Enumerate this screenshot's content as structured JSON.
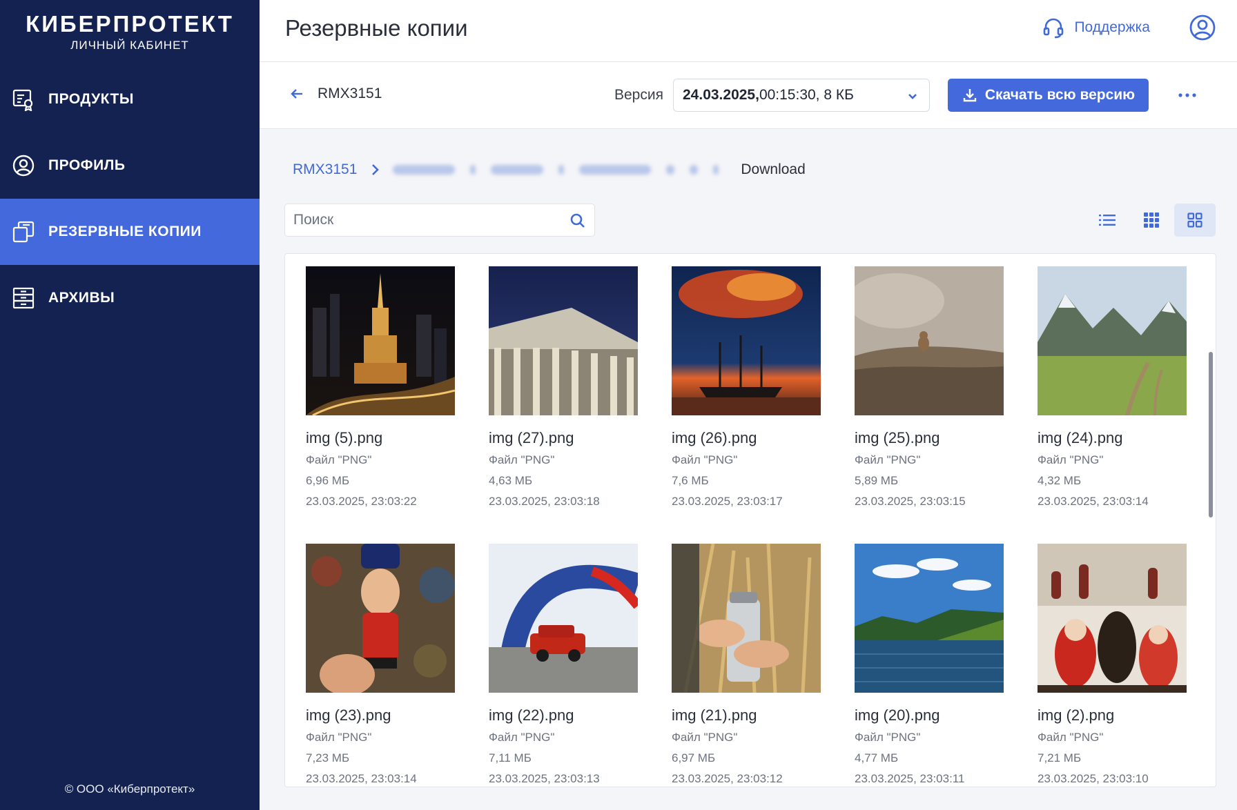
{
  "brand": {
    "name": "КИБЕРПРОТЕКТ",
    "subtitle": "ЛИЧНЫЙ КАБИНЕТ"
  },
  "nav": [
    {
      "label": "ПРОДУКТЫ",
      "icon": "products-icon",
      "active": false
    },
    {
      "label": "ПРОФИЛЬ",
      "icon": "profile-icon",
      "active": false
    },
    {
      "label": "РЕЗЕРВНЫЕ КОПИИ",
      "icon": "backups-icon",
      "active": true
    },
    {
      "label": "АРХИВЫ",
      "icon": "archives-icon",
      "active": false
    }
  ],
  "copyright": "© ООО «Киберпротект»",
  "header": {
    "title": "Резервные копии",
    "support": "Поддержка"
  },
  "versionbar": {
    "device": "RMX3151",
    "version_label": "Версия",
    "version_date": "24.03.2025,",
    "version_rest": "00:15:30, 8 КБ",
    "download": "Скачать всю версию"
  },
  "breadcrumb": {
    "root": "RMX3151",
    "current": "Download"
  },
  "search": {
    "placeholder": "Поиск",
    "value": ""
  },
  "colors": {
    "sidebar": "#142251",
    "accent": "#4469dd",
    "link": "#4169d8"
  },
  "files": [
    {
      "name": "img (5).png",
      "type": "Файл \"PNG\"",
      "size": "6,96 МБ",
      "date": "23.03.2025, 23:03:22"
    },
    {
      "name": "img (27).png",
      "type": "Файл \"PNG\"",
      "size": "4,63 МБ",
      "date": "23.03.2025, 23:03:18"
    },
    {
      "name": "img (26).png",
      "type": "Файл \"PNG\"",
      "size": "7,6 МБ",
      "date": "23.03.2025, 23:03:17"
    },
    {
      "name": "img (25).png",
      "type": "Файл \"PNG\"",
      "size": "5,89 МБ",
      "date": "23.03.2025, 23:03:15"
    },
    {
      "name": "img (24).png",
      "type": "Файл \"PNG\"",
      "size": "4,32 МБ",
      "date": "23.03.2025, 23:03:14"
    },
    {
      "name": "img (23).png",
      "type": "Файл \"PNG\"",
      "size": "7,23 МБ",
      "date": "23.03.2025, 23:03:14"
    },
    {
      "name": "img (22).png",
      "type": "Файл \"PNG\"",
      "size": "7,11 МБ",
      "date": "23.03.2025, 23:03:13"
    },
    {
      "name": "img (21).png",
      "type": "Файл \"PNG\"",
      "size": "6,97 МБ",
      "date": "23.03.2025, 23:03:12"
    },
    {
      "name": "img (20).png",
      "type": "Файл \"PNG\"",
      "size": "4,77 МБ",
      "date": "23.03.2025, 23:03:11"
    },
    {
      "name": "img (2).png",
      "type": "Файл \"PNG\"",
      "size": "7,21 МБ",
      "date": "23.03.2025, 23:03:10"
    }
  ]
}
